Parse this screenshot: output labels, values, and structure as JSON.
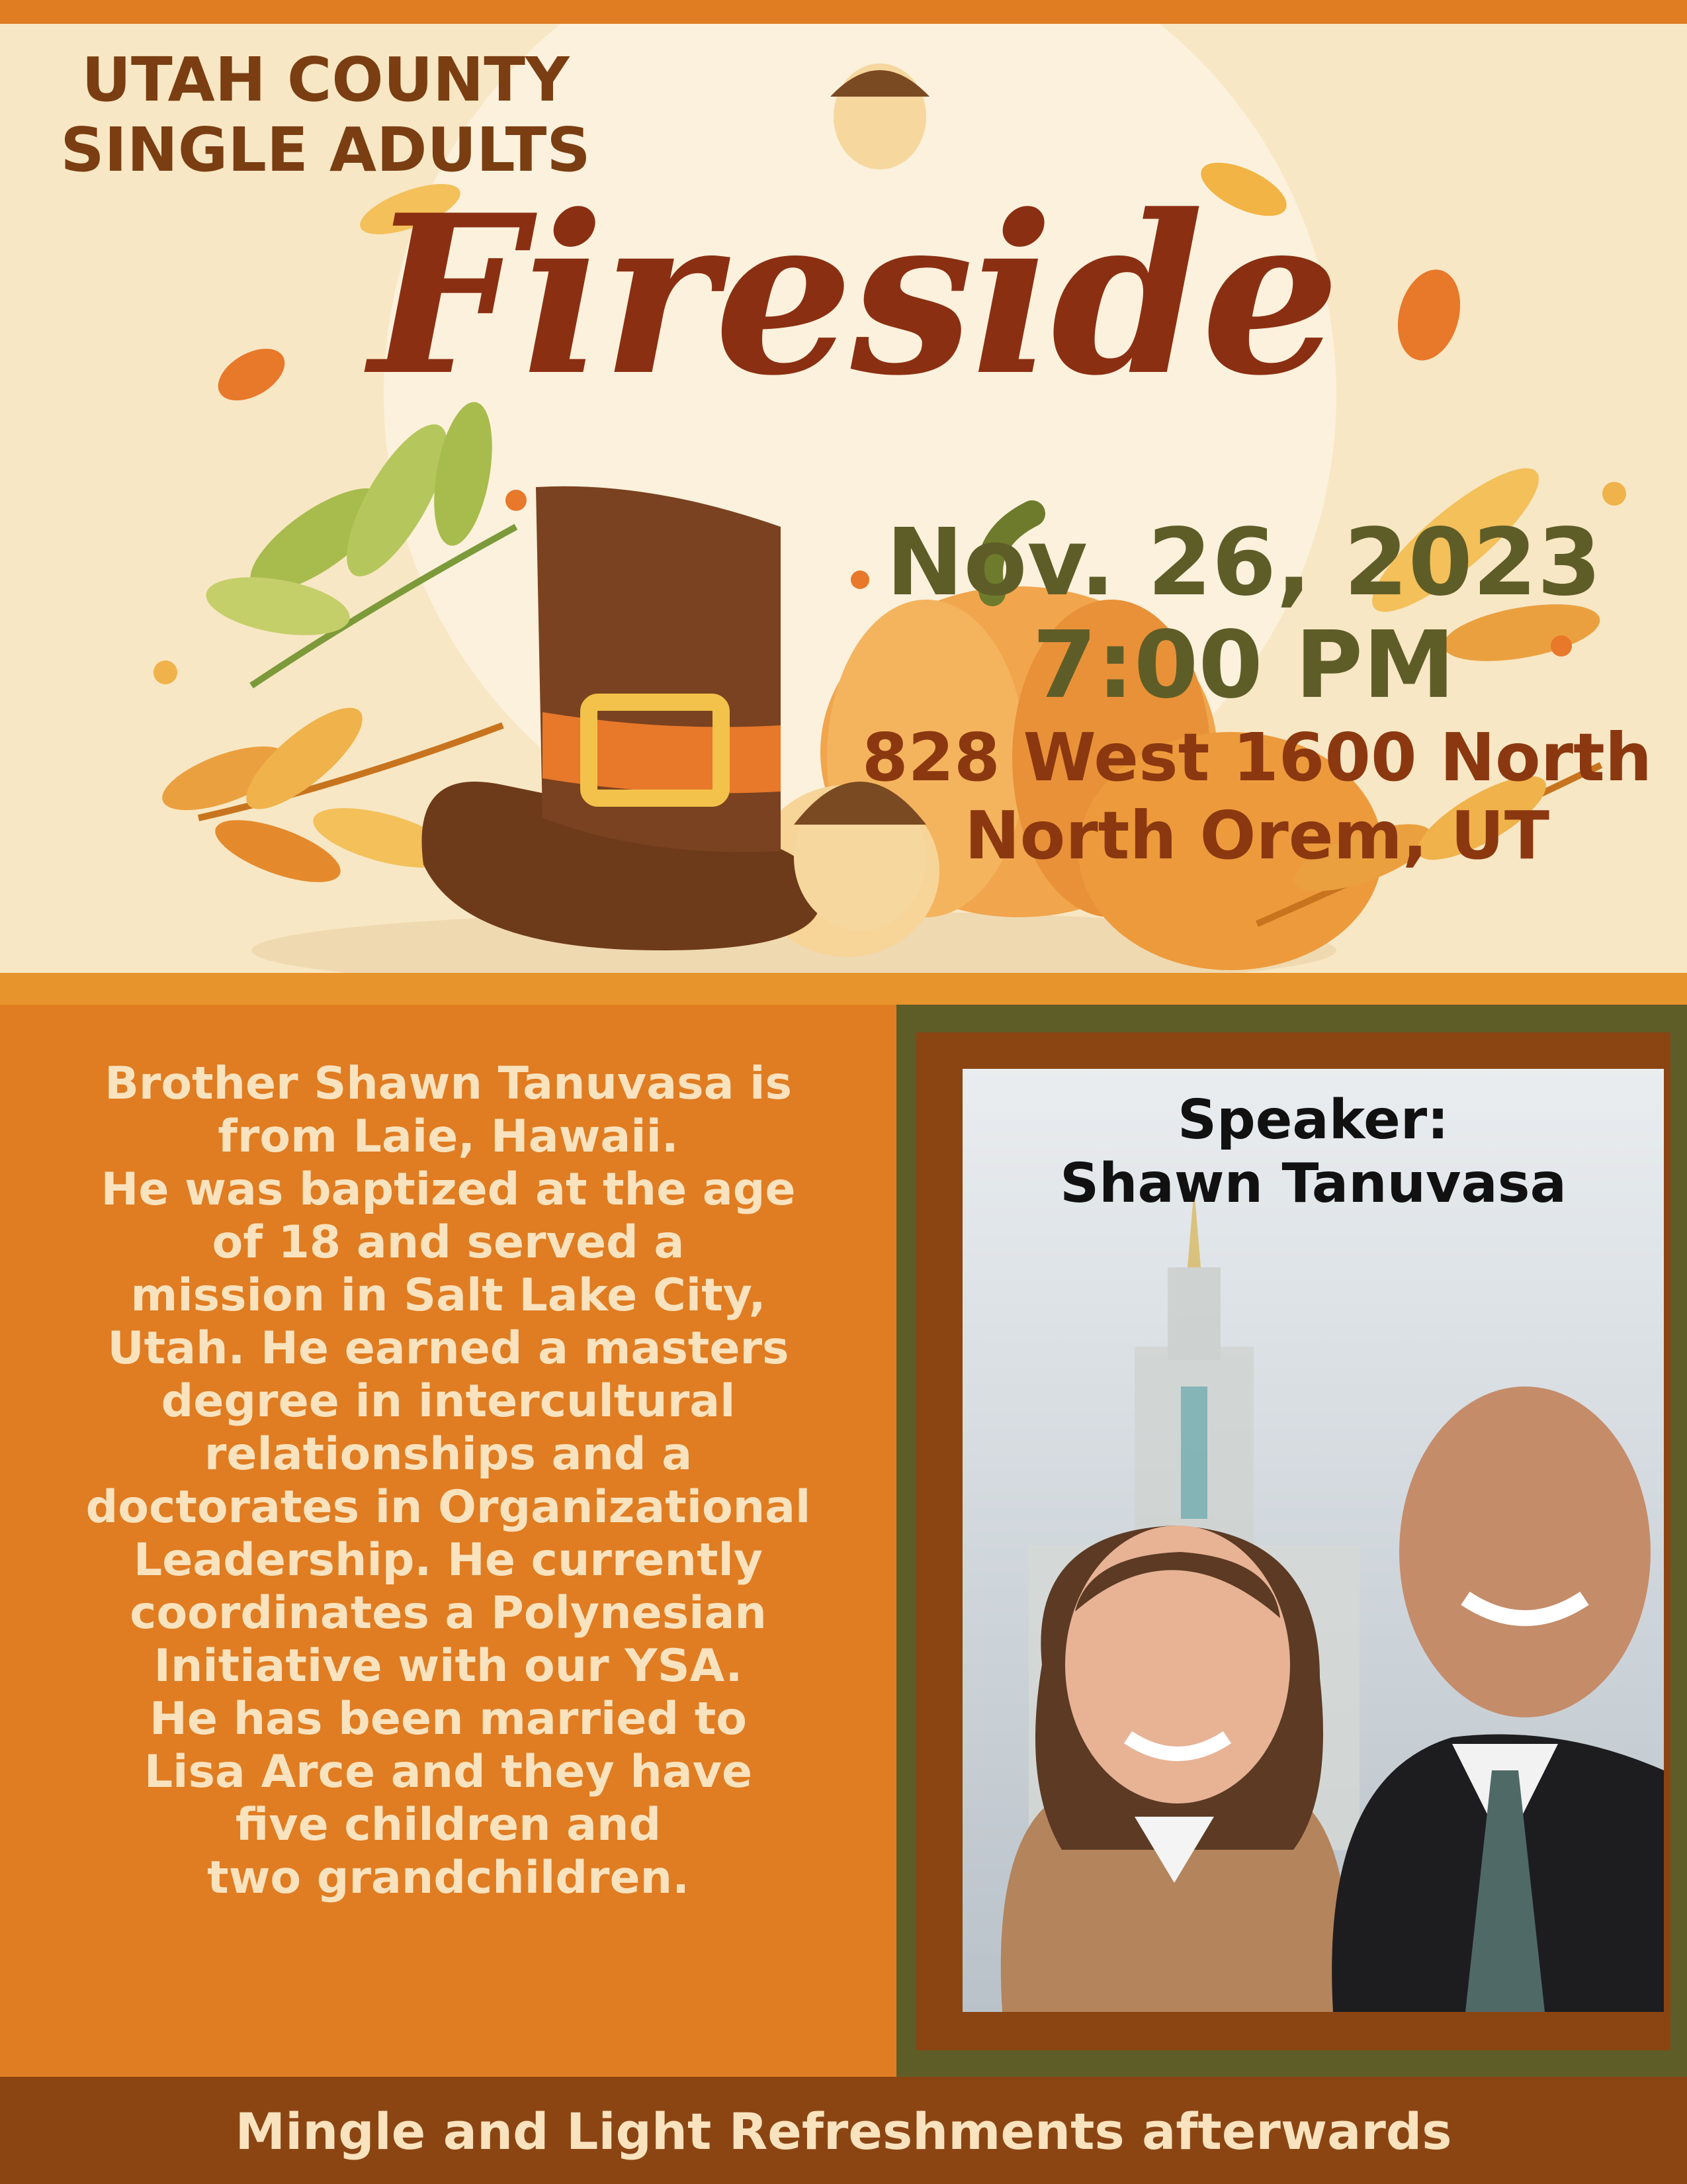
{
  "header": {
    "org_title": "UTAH COUNTY\nSINGLE ADULTS",
    "event_title": "Fireside"
  },
  "event": {
    "date": "Nov. 26, 2023",
    "time": "7:00 PM",
    "address": "828 West 1600 North\nNorth Orem, UT"
  },
  "bio": {
    "lines": [
      "Brother Shawn Tanuvasa is",
      "from Laie, Hawaii.",
      "He was baptized at the age",
      "of 18 and served a",
      "mission in Salt Lake City,",
      "Utah.  He earned a masters",
      "degree in intercultural",
      "relationships and a",
      "doctorates in Organizational",
      "Leadership. He currently",
      "coordinates a Polynesian",
      "Initiative with our YSA.",
      "He has been married to",
      "Lisa Arce and they have",
      "five children and",
      "two grandchildren."
    ]
  },
  "speaker": {
    "caption": "Speaker:\nShawn Tanuvasa"
  },
  "footer": {
    "text": "Mingle and Light Refreshments afterwards"
  },
  "colors": {
    "orange": "#e07c22",
    "brown": "#8b4513",
    "olive": "#5e5d28",
    "cream": "#f9e3bf",
    "title_red_brown": "#8b2f12"
  }
}
